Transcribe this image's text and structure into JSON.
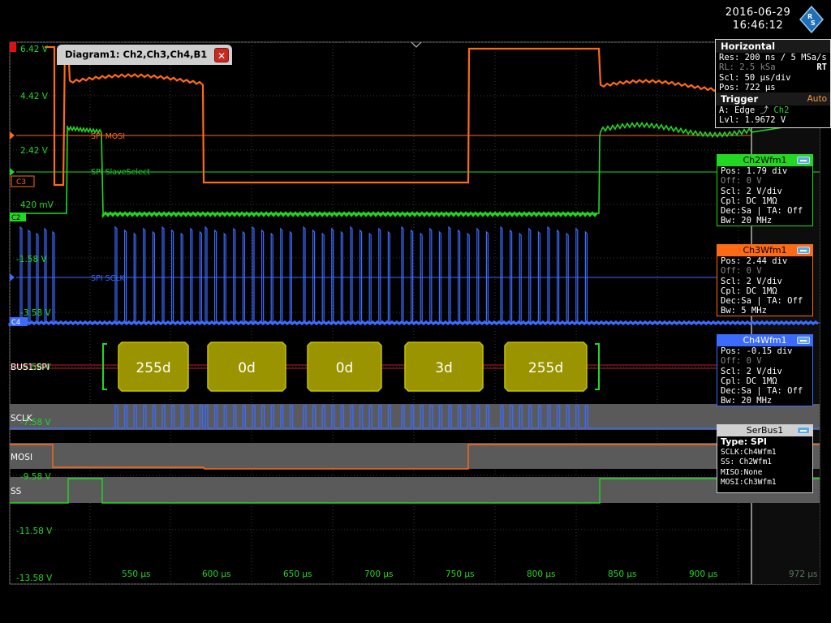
{
  "datetime": {
    "date": "2016-06-29",
    "time": "16:46:12"
  },
  "diagram": {
    "title": "Diagram1: Ch2,Ch3,Ch4,B1",
    "close_glyph": "✕"
  },
  "horizontal": {
    "title": "Horizontal",
    "res": "Res: 200 ns / 5 MSa/s",
    "rl": "RL: 2.5 kSa",
    "rt": "RT",
    "scl": "Scl: 50 µs/div",
    "pos": "Pos: 722 µs"
  },
  "trigger": {
    "title": "Trigger",
    "mode": "Auto",
    "line_a": "A:   Edge",
    "source": "Ch2",
    "lvl": "Lvl: 1.9672 V"
  },
  "ch2": {
    "title": "Ch2Wfm1",
    "pos": "Pos: 1.79 div",
    "off": "Off: 0 V",
    "scl": "Scl: 2 V/div",
    "cpl": "Cpl: DC 1MΩ",
    "dec": "Dec:Sa | TA: Off",
    "bw": "Bw: 20 MHz"
  },
  "ch3": {
    "title": "Ch3Wfm1",
    "pos": "Pos: 2.44 div",
    "off": "Off: 0 V",
    "scl": "Scl: 2 V/div",
    "cpl": "Cpl: DC 1MΩ",
    "dec": "Dec:Sa | TA: Off",
    "bw": "Bw: 5 MHz"
  },
  "ch4": {
    "title": "Ch4Wfm1",
    "pos": "Pos: -0.15 div",
    "off": "Off: 0 V",
    "scl": "Scl: 2 V/div",
    "cpl": "Cpl: DC 1MΩ",
    "dec": "Dec:Sa | TA: Off",
    "bw": "Bw: 20 MHz"
  },
  "serbus": {
    "title": "SerBus1",
    "type": "Type: SPI",
    "sclk": "SCLK:Ch4Wfm1",
    "ss": "SS:   Ch2Wfm1",
    "miso": "MISO:None",
    "mosi": "MOSI:Ch3Wfm1"
  },
  "voltage_labels": [
    "6.42 V",
    "4.42 V",
    "2.42 V",
    "420 mV",
    "-1.58 V",
    "-3.58 V",
    "-5.58 V",
    "-7.58 V",
    "-9.58 V",
    "-11.58 V",
    "-13.58 V"
  ],
  "time_labels": [
    "550 µs",
    "600 µs",
    "650 µs",
    "700 µs",
    "750 µs",
    "800 µs",
    "850 µs",
    "900 µs"
  ],
  "time_label_end": "972 µs",
  "signal_labels": {
    "mosi": "SPI MOSI",
    "ss": "SPI SlaveSelect",
    "sclk": "SPI SCLK"
  },
  "marker_labels": {
    "c3": "C3",
    "c2": "C2",
    "c4": "C4"
  },
  "bus_values": [
    "255d",
    "0d",
    "0d",
    "3d",
    "255d"
  ],
  "bus_labels": {
    "bus": "BUS1:SPI",
    "sclk": "SCLK",
    "mosi": "MOSI",
    "ss": "SS"
  },
  "colors": {
    "ch2": "#22d822",
    "ch3": "#ff6a14",
    "ch4": "#3b6bff",
    "bus_fill": "#9a9400",
    "bus_edge": "#c8c200",
    "accent": "#5fa8e8"
  }
}
